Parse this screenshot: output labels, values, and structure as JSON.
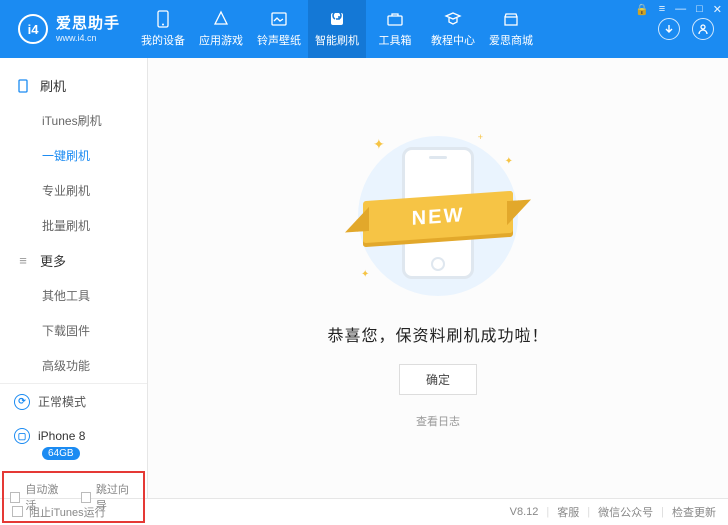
{
  "brand": {
    "title": "爱思助手",
    "url": "www.i4.cn",
    "logo_text": "i4"
  },
  "nav": {
    "items": [
      {
        "label": "我的设备"
      },
      {
        "label": "应用游戏"
      },
      {
        "label": "铃声壁纸"
      },
      {
        "label": "智能刷机"
      },
      {
        "label": "工具箱"
      },
      {
        "label": "教程中心"
      },
      {
        "label": "爱思商城"
      }
    ],
    "active_index": 3
  },
  "sidebar": {
    "group1": {
      "title": "刷机",
      "items": [
        "iTunes刷机",
        "一键刷机",
        "专业刷机",
        "批量刷机"
      ],
      "active_index": 1
    },
    "group2": {
      "title": "更多",
      "items": [
        "其他工具",
        "下载固件",
        "高级功能"
      ]
    },
    "mode": {
      "label": "正常模式"
    },
    "device": {
      "name": "iPhone 8",
      "storage": "64GB"
    },
    "bottom_checks": {
      "auto_activate": "自动激活",
      "skip_guide": "跳过向导"
    }
  },
  "main": {
    "ribbon_text": "NEW",
    "success_message": "恭喜您，保资料刷机成功啦！",
    "ok_button": "确定",
    "view_log": "查看日志"
  },
  "statusbar": {
    "block_itunes": "阻止iTunes运行",
    "version": "V8.12",
    "support": "客服",
    "wechat": "微信公众号",
    "update": "检查更新"
  }
}
